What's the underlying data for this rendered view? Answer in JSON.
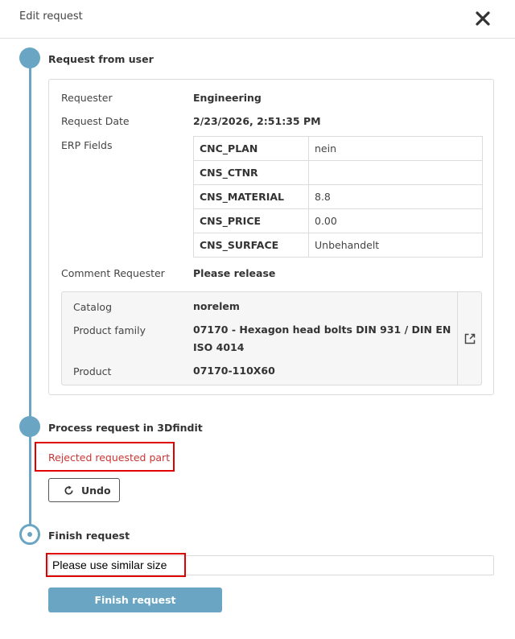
{
  "header": {
    "title": "Edit request"
  },
  "steps": {
    "request_from_user": {
      "title": "Request from user",
      "requester_label": "Requester",
      "requester_value": "Engineering",
      "date_label": "Request Date",
      "date_value": "2/23/2026, 2:51:35 PM",
      "erp_label": "ERP Fields",
      "erp_fields": [
        {
          "key": "CNC_PLAN",
          "value": "nein"
        },
        {
          "key": "CNS_CTNR",
          "value": ""
        },
        {
          "key": "CNS_MATERIAL",
          "value": "8.8"
        },
        {
          "key": "CNS_PRICE",
          "value": "0.00"
        },
        {
          "key": "CNS_SURFACE",
          "value": "Unbehandelt"
        }
      ],
      "comment_label": "Comment Requester",
      "comment_value": "Please release",
      "product": {
        "catalog_label": "Catalog",
        "catalog_value": "norelem",
        "family_label": "Product family",
        "family_value": "07170 - Hexagon head bolts DIN 931 / DIN EN ISO 4014",
        "product_label": "Product",
        "product_value": "07170-110X60"
      }
    },
    "process": {
      "title": "Process request in 3Dfindit",
      "status": "Rejected requested part",
      "undo_label": "Undo"
    },
    "finish": {
      "title": "Finish request",
      "input_value": "Please use similar size",
      "button_label": "Finish request"
    }
  },
  "colors": {
    "accent": "#6aa6c3",
    "highlight": "#e00000",
    "rejected_text": "#cc3333"
  }
}
